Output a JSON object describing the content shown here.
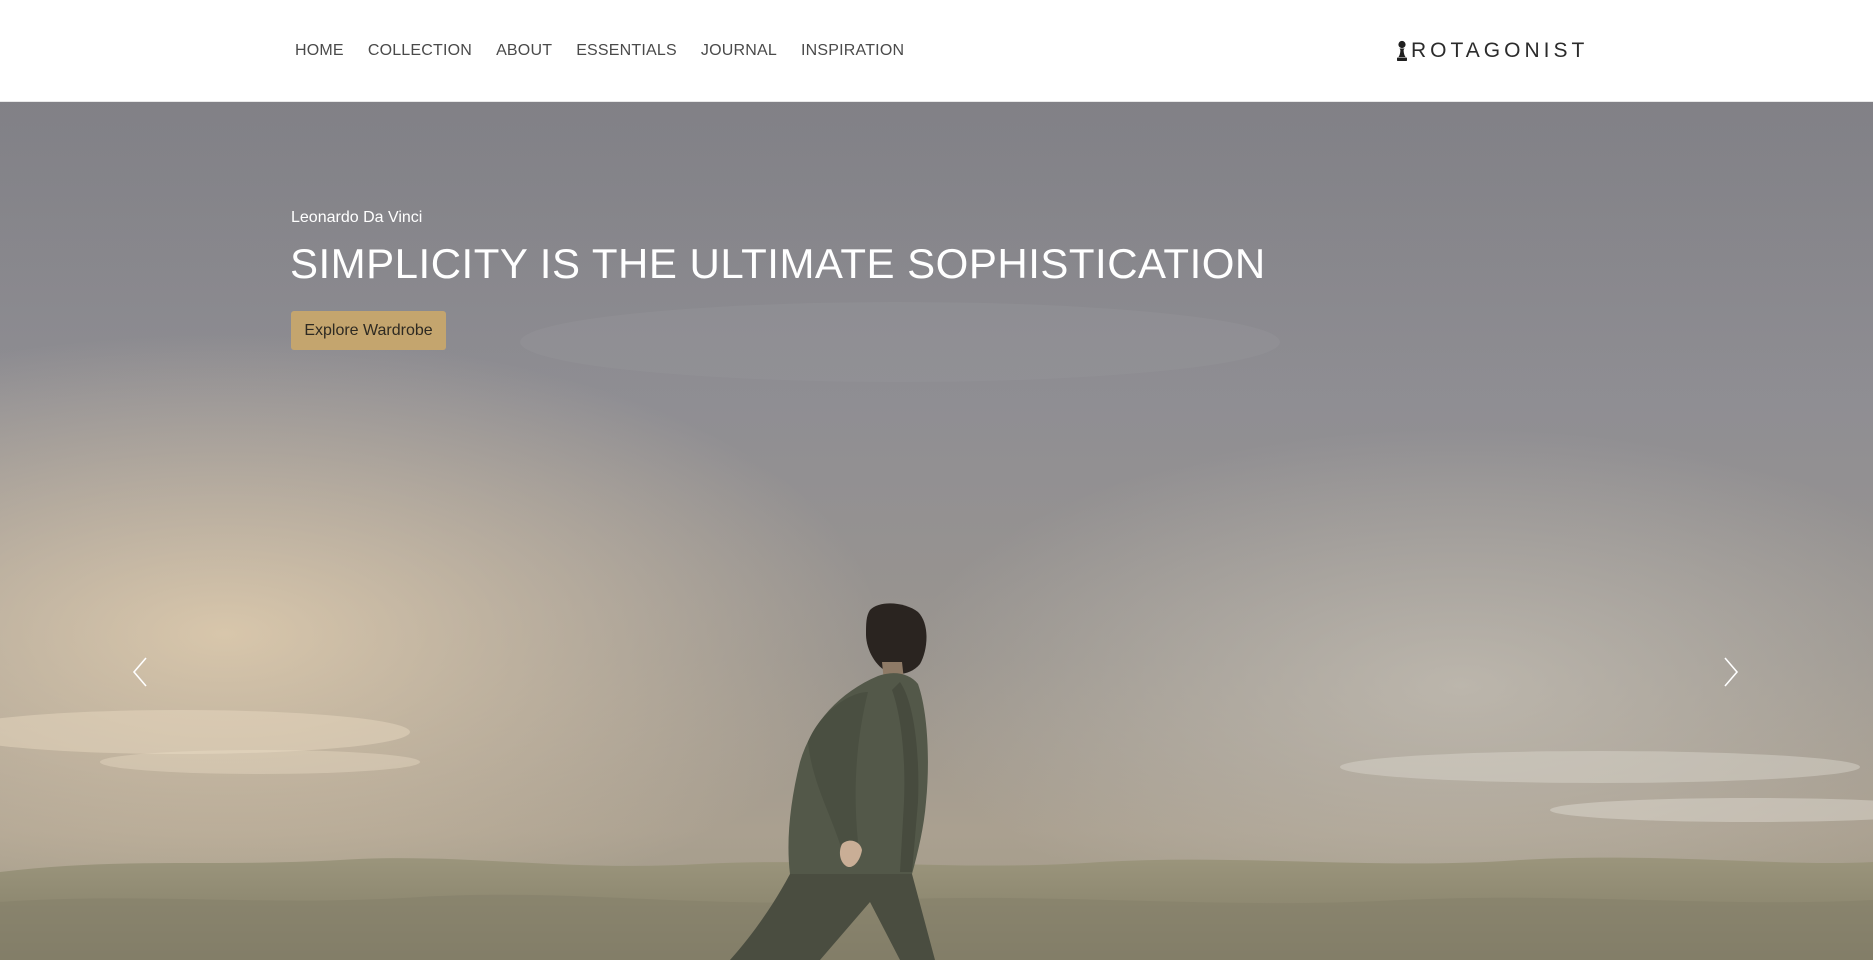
{
  "nav": {
    "items": [
      {
        "label": "HOME"
      },
      {
        "label": "COLLECTION"
      },
      {
        "label": "ABOUT"
      },
      {
        "label": "ESSENTIALS"
      },
      {
        "label": "JOURNAL"
      },
      {
        "label": "INSPIRATION"
      }
    ]
  },
  "logo": {
    "text": "ROTAGONIST",
    "icon": "chess-pawn-icon"
  },
  "hero": {
    "author": "Leonardo Da Vinci",
    "title": "SIMPLICITY IS THE ULTIMATE SOPHISTICATION",
    "cta_label": "Explore Wardrobe",
    "prev_icon": "chevron-left-icon",
    "next_icon": "chevron-right-icon"
  },
  "colors": {
    "accent": "#c4a56e",
    "nav_text": "#4a4a4a",
    "hero_text": "#ffffff",
    "sky_top": "#8a8a8f",
    "sky_warm": "#d8c4a8",
    "ground": "#8e8870",
    "figure": "#4e5345"
  }
}
